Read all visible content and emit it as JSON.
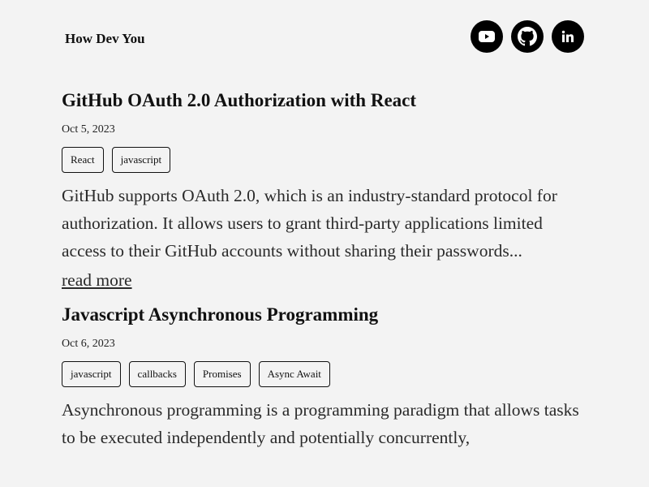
{
  "header": {
    "site_title": "How Dev You",
    "socials": [
      {
        "name": "youtube",
        "icon": "youtube-icon"
      },
      {
        "name": "github",
        "icon": "github-icon"
      },
      {
        "name": "linkedin",
        "icon": "linkedin-icon",
        "glyph": "in"
      }
    ]
  },
  "posts": [
    {
      "title": "GitHub OAuth 2.0 Authorization with React",
      "date": "Oct 5, 2023",
      "tags": [
        "React",
        "javascript"
      ],
      "excerpt": "GitHub supports OAuth 2.0, which is an industry-standard protocol for authorization. It allows users to grant third-party applications limited access to their GitHub accounts without sharing their passwords...",
      "read_more": "read more"
    },
    {
      "title": "Javascript Asynchronous Programming",
      "date": "Oct 6, 2023",
      "tags": [
        "javascript",
        "callbacks",
        "Promises",
        "Async Await"
      ],
      "excerpt": "Asynchronous programming is a programming paradigm that allows tasks to be executed independently and potentially concurrently,"
    }
  ],
  "colors": {
    "background": "#f3f3f3",
    "text": "#111111",
    "icon_bg": "#000000"
  }
}
